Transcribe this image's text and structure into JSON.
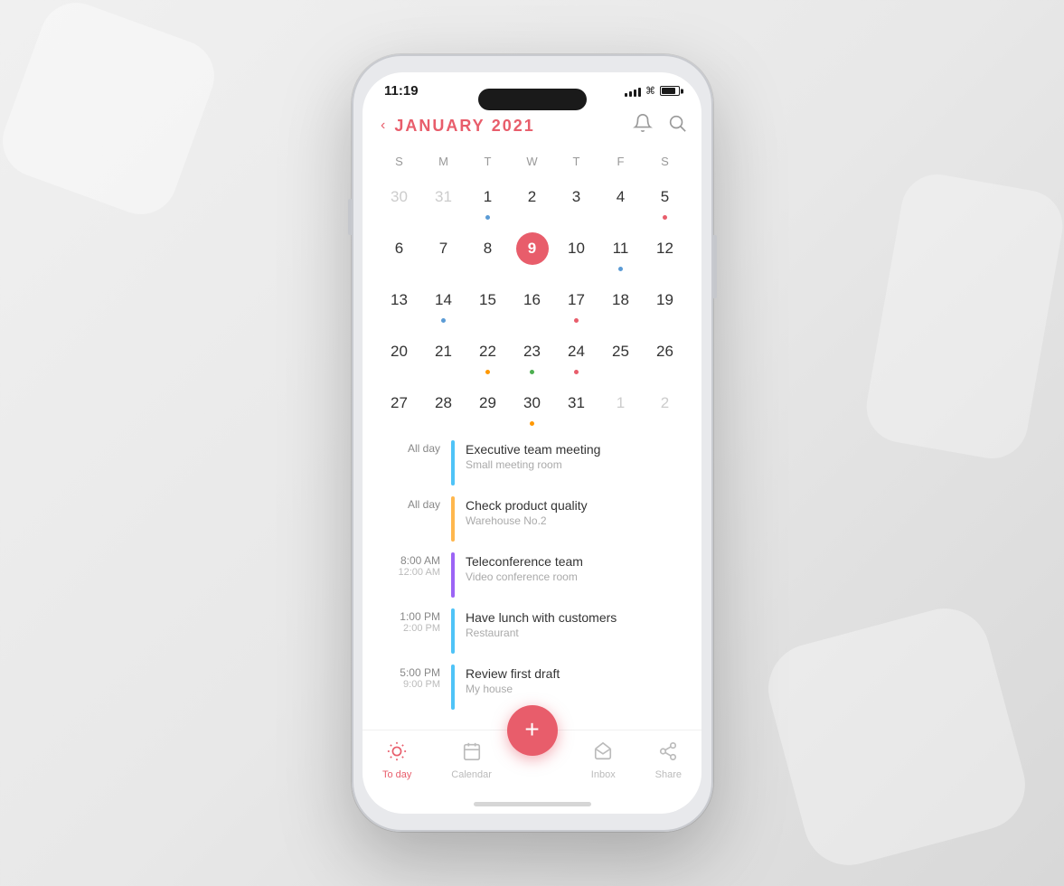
{
  "background": {
    "color": "#e8e8e8"
  },
  "phone": {
    "status_bar": {
      "time": "11:19",
      "camera_dot": "●"
    },
    "header": {
      "nav_arrow": "‹",
      "month": "JANUARY",
      "year": "2021",
      "bell_icon": "bell",
      "search_icon": "search"
    },
    "calendar": {
      "day_headers": [
        "S",
        "M",
        "T",
        "W",
        "T",
        "F",
        "S"
      ],
      "weeks": [
        [
          {
            "num": "30",
            "other": true,
            "dot": null
          },
          {
            "num": "31",
            "other": true,
            "dot": null
          },
          {
            "num": "1",
            "dot": "blue"
          },
          {
            "num": "2",
            "dot": null
          },
          {
            "num": "3",
            "dot": null
          },
          {
            "num": "4",
            "dot": null
          },
          {
            "num": "5",
            "dot": "red"
          }
        ],
        [
          {
            "num": "6",
            "dot": null
          },
          {
            "num": "7",
            "dot": null
          },
          {
            "num": "8",
            "dot": null
          },
          {
            "num": "9",
            "today": true,
            "dot": null
          },
          {
            "num": "10",
            "dot": null
          },
          {
            "num": "11",
            "dot": "blue"
          },
          {
            "num": "12",
            "dot": null
          }
        ],
        [
          {
            "num": "13",
            "dot": null
          },
          {
            "num": "14",
            "dot": "blue"
          },
          {
            "num": "15",
            "dot": null
          },
          {
            "num": "16",
            "dot": null
          },
          {
            "num": "17",
            "dot": "red"
          },
          {
            "num": "18",
            "dot": null
          },
          {
            "num": "19",
            "dot": null
          }
        ],
        [
          {
            "num": "20",
            "dot": null
          },
          {
            "num": "21",
            "dot": null
          },
          {
            "num": "22",
            "dot": "orange"
          },
          {
            "num": "23",
            "dot": "green"
          },
          {
            "num": "24",
            "dot": "red"
          },
          {
            "num": "25",
            "dot": null
          },
          {
            "num": "26",
            "dot": null
          }
        ],
        [
          {
            "num": "27",
            "dot": null
          },
          {
            "num": "28",
            "dot": null
          },
          {
            "num": "29",
            "dot": null
          },
          {
            "num": "30",
            "dot": "orange"
          },
          {
            "num": "31",
            "dot": null
          },
          {
            "num": "1",
            "other": true,
            "dot": null
          },
          {
            "num": "2",
            "other": true,
            "dot": null
          }
        ]
      ]
    },
    "events": [
      {
        "time_main": "All day",
        "time_end": "",
        "bar_color": "#4fc3f7",
        "title": "Executive team meeting",
        "location": "Small meeting room"
      },
      {
        "time_main": "All day",
        "time_end": "",
        "bar_color": "#ffb74d",
        "title": "Check product quality",
        "location": "Warehouse  No.2"
      },
      {
        "time_main": "8:00 AM",
        "time_end": "12:00 AM",
        "bar_color": "#9c64f5",
        "title": "Teleconference team",
        "location": "Video conference room"
      },
      {
        "time_main": "1:00 PM",
        "time_end": "2:00 PM",
        "bar_color": "#4fc3f7",
        "title": "Have lunch with customers",
        "location": "Restaurant"
      },
      {
        "time_main": "5:00 PM",
        "time_end": "9:00 PM",
        "bar_color": "#4fc3f7",
        "title": "Review first draft",
        "location": "My house"
      }
    ],
    "nav": {
      "today_label": "To day",
      "calendar_label": "Calendar",
      "inbox_label": "Inbox",
      "share_label": "Share",
      "fab_icon": "+"
    }
  }
}
